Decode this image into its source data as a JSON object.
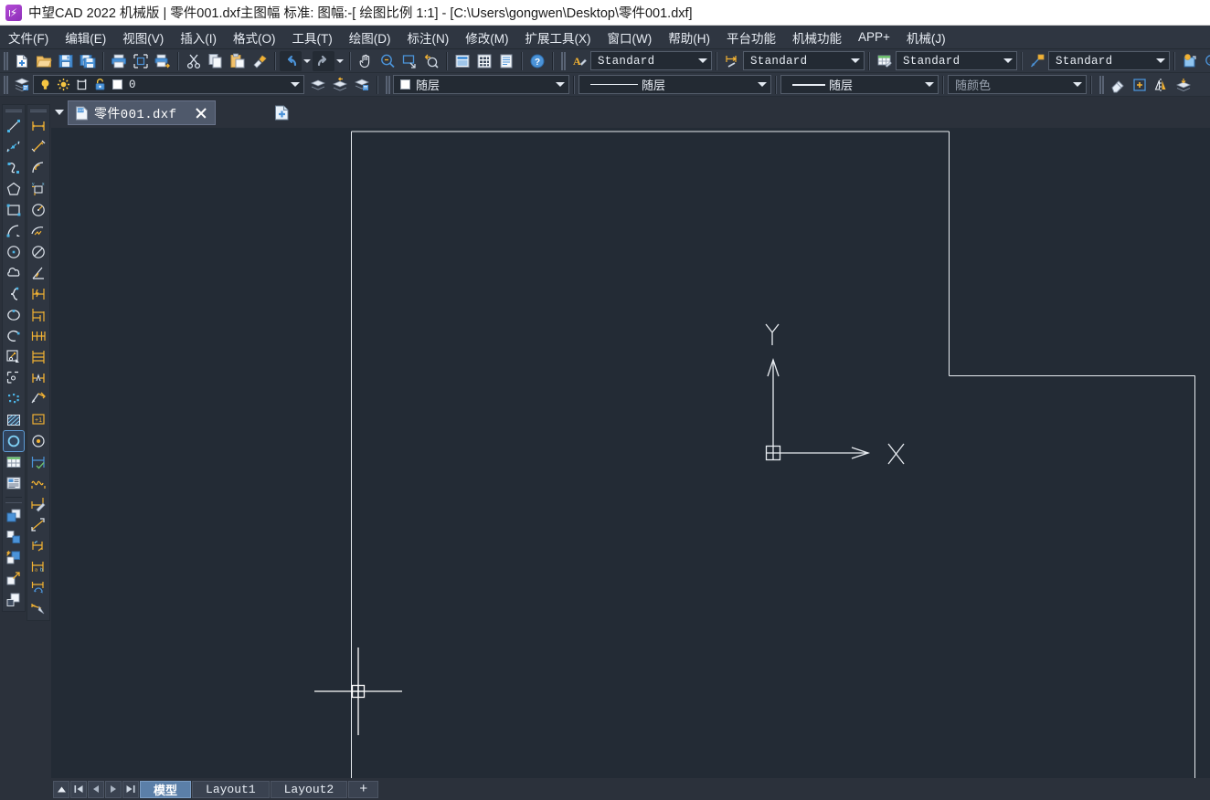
{
  "window": {
    "title": "中望CAD 2022 机械版 | 零件001.dxf主图幅  标准: 图幅:-[ 绘图比例 1:1] - [C:\\Users\\gongwen\\Desktop\\零件001.dxf]",
    "app_name": "中望CAD 2022 机械版",
    "drawing_name": "零件001.dxf主图幅",
    "standard_info": "标准: 图幅:-[ 绘图比例 1:1]",
    "file_path": "C:\\Users\\gongwen\\Desktop\\零件001.dxf",
    "logo_icon": "zwcad-logo-icon"
  },
  "menubar": {
    "items": [
      {
        "label": "文件(F)",
        "mnemonic": "F"
      },
      {
        "label": "编辑(E)",
        "mnemonic": "E"
      },
      {
        "label": "视图(V)",
        "mnemonic": "V"
      },
      {
        "label": "插入(I)",
        "mnemonic": "I"
      },
      {
        "label": "格式(O)",
        "mnemonic": "O"
      },
      {
        "label": "工具(T)",
        "mnemonic": "T"
      },
      {
        "label": "绘图(D)",
        "mnemonic": "D"
      },
      {
        "label": "标注(N)",
        "mnemonic": "N"
      },
      {
        "label": "修改(M)",
        "mnemonic": "M"
      },
      {
        "label": "扩展工具(X)",
        "mnemonic": "X"
      },
      {
        "label": "窗口(W)",
        "mnemonic": "W"
      },
      {
        "label": "帮助(H)",
        "mnemonic": "H"
      },
      {
        "label": "平台功能",
        "mnemonic": ""
      },
      {
        "label": "机械功能",
        "mnemonic": ""
      },
      {
        "label": "APP+",
        "mnemonic": ""
      },
      {
        "label": "机械(J)",
        "mnemonic": "J"
      }
    ]
  },
  "standard_toolbar": {
    "buttons": [
      {
        "name": "new-file-icon",
        "tooltip": "新建"
      },
      {
        "name": "open-file-icon",
        "tooltip": "打开"
      },
      {
        "name": "save-icon",
        "tooltip": "保存"
      },
      {
        "name": "save-as-icon",
        "tooltip": "另存为"
      },
      {
        "name": "print-icon",
        "tooltip": "打印"
      },
      {
        "name": "print-preview-icon",
        "tooltip": "打印预览"
      },
      {
        "name": "plot-icon",
        "tooltip": "输出"
      },
      {
        "name": "cut-icon",
        "tooltip": "剪切"
      },
      {
        "name": "copy-icon",
        "tooltip": "复制"
      },
      {
        "name": "paste-icon",
        "tooltip": "粘贴"
      },
      {
        "name": "match-properties-icon",
        "tooltip": "特性匹配"
      },
      {
        "name": "undo-icon",
        "tooltip": "放弃"
      },
      {
        "name": "redo-icon",
        "tooltip": "重做"
      },
      {
        "name": "pan-icon",
        "tooltip": "实时平移"
      },
      {
        "name": "zoom-realtime-icon",
        "tooltip": "实时缩放"
      },
      {
        "name": "zoom-window-icon",
        "tooltip": "窗口缩放"
      },
      {
        "name": "zoom-previous-icon",
        "tooltip": "缩放上一个"
      },
      {
        "name": "properties-icon",
        "tooltip": "特性"
      },
      {
        "name": "design-center-icon",
        "tooltip": "设计中心"
      },
      {
        "name": "tool-palette-icon",
        "tooltip": "工具选项板"
      },
      {
        "name": "help-icon",
        "tooltip": "帮助"
      }
    ]
  },
  "style_bar": {
    "text_style": {
      "icon": "text-style-icon",
      "value": "Standard"
    },
    "dim_style": {
      "icon": "dimension-style-icon",
      "value": "Standard"
    },
    "table_style": {
      "icon": "table-style-icon",
      "value": "Standard"
    },
    "mleader_style": {
      "icon": "multileader-style-icon",
      "value": "Standard"
    },
    "extra_buttons": [
      {
        "name": "insert-block-icon"
      },
      {
        "name": "zoom-scale-icon"
      },
      {
        "name": "xy-plot-icon"
      },
      {
        "name": "dim-extra-icon"
      }
    ]
  },
  "layer_bar": {
    "layer_manager": {
      "name": "layer-manager-icon",
      "tooltip": "图层特性管理器"
    },
    "layer_state": {
      "on_off_icon": "lightbulb-icon",
      "freeze_icon": "sun-icon",
      "viewport_freeze_icon": "viewport-freeze-icon",
      "lock_icon": "unlock-icon",
      "color_icon": "layer-color-swatch",
      "layer_name": "0"
    },
    "right_buttons": [
      {
        "name": "layer-previous-icon"
      },
      {
        "name": "layer-restore-icon"
      },
      {
        "name": "layer-states-icon"
      }
    ]
  },
  "property_bar": {
    "color": {
      "value": "随层",
      "swatch": "white",
      "icon": "color-swatch-icon"
    },
    "linetype": {
      "value": "随层",
      "icon": "linetype-sample-icon"
    },
    "lineweight": {
      "value": "随层",
      "icon": "lineweight-sample-icon"
    },
    "plot_style": {
      "value": "随颜色",
      "enabled": false
    },
    "right_buttons": [
      {
        "name": "eraser-icon"
      },
      {
        "name": "add-selected-icon"
      },
      {
        "name": "mirror-icon"
      },
      {
        "name": "layer-merge-icon"
      }
    ]
  },
  "document_tabs": {
    "dropdown_icon": "chevron-down-icon",
    "tabs": [
      {
        "label": "零件001.dxf",
        "icon": "dxf-file-icon",
        "active": true,
        "close_icon": "close-icon"
      }
    ],
    "new_tab_icon": "new-tab-icon"
  },
  "draw_toolbar": {
    "title": "绘图",
    "buttons": [
      {
        "name": "line-icon",
        "tooltip": "直线"
      },
      {
        "name": "construction-line-icon",
        "tooltip": "构造线"
      },
      {
        "name": "polyline-icon",
        "tooltip": "多段线"
      },
      {
        "name": "polygon-icon",
        "tooltip": "正多边形"
      },
      {
        "name": "rectangle-icon",
        "tooltip": "矩形"
      },
      {
        "name": "arc-icon",
        "tooltip": "圆弧"
      },
      {
        "name": "circle-icon",
        "tooltip": "圆"
      },
      {
        "name": "revision-cloud-icon",
        "tooltip": "修订云线"
      },
      {
        "name": "spline-icon",
        "tooltip": "样条曲线"
      },
      {
        "name": "ellipse-icon",
        "tooltip": "椭圆"
      },
      {
        "name": "ellipse-arc-icon",
        "tooltip": "椭圆弧"
      },
      {
        "name": "insert-block-icon",
        "tooltip": "插入块"
      },
      {
        "name": "make-block-icon",
        "tooltip": "创建块"
      },
      {
        "name": "point-icon",
        "tooltip": "点"
      },
      {
        "name": "hatch-icon",
        "tooltip": "图案填充"
      },
      {
        "name": "gradient-icon",
        "tooltip": "渐变色"
      },
      {
        "name": "region-icon",
        "tooltip": "面域"
      },
      {
        "name": "table-icon",
        "tooltip": "表格"
      },
      {
        "name": "mtext-icon",
        "tooltip": "多行文字"
      }
    ]
  },
  "modify_toolbar": {
    "title": "修改",
    "buttons": [
      {
        "name": "copy-object-icon",
        "tooltip": "复制"
      },
      {
        "name": "move-icon",
        "tooltip": "移动"
      },
      {
        "name": "rotate-icon",
        "tooltip": "旋转"
      },
      {
        "name": "scale-icon",
        "tooltip": "缩放"
      },
      {
        "name": "trim-icon",
        "tooltip": "修剪"
      }
    ]
  },
  "dimension_toolbar": {
    "title": "标注",
    "buttons": [
      {
        "name": "linear-dimension-icon",
        "tooltip": "线性标注"
      },
      {
        "name": "aligned-dimension-icon",
        "tooltip": "对齐标注"
      },
      {
        "name": "arc-length-dimension-icon",
        "tooltip": "弧长标注"
      },
      {
        "name": "ordinate-dimension-icon",
        "tooltip": "坐标标注"
      },
      {
        "name": "radius-dimension-icon",
        "tooltip": "半径标注"
      },
      {
        "name": "jogged-dimension-icon",
        "tooltip": "折弯标注"
      },
      {
        "name": "diameter-dimension-icon",
        "tooltip": "直径标注"
      },
      {
        "name": "angular-dimension-icon",
        "tooltip": "角度标注"
      },
      {
        "name": "quick-dimension-icon",
        "tooltip": "快速标注"
      },
      {
        "name": "baseline-dimension-icon",
        "tooltip": "基线标注"
      },
      {
        "name": "continue-dimension-icon",
        "tooltip": "连续标注"
      },
      {
        "name": "dim-space-icon",
        "tooltip": "标注间距"
      },
      {
        "name": "dim-break-icon",
        "tooltip": "标注打断"
      },
      {
        "name": "tolerance-icon",
        "tooltip": "公差"
      },
      {
        "name": "center-mark-icon",
        "tooltip": "圆心标记"
      },
      {
        "name": "inspection-dimension-icon",
        "tooltip": "检验"
      },
      {
        "name": "jogged-linear-icon",
        "tooltip": "折弯线性"
      },
      {
        "name": "edit-dimension-icon",
        "tooltip": "编辑标注"
      },
      {
        "name": "edit-dim-text-icon",
        "tooltip": "编辑标注文字"
      },
      {
        "name": "dim-update-icon",
        "tooltip": "标注更新"
      },
      {
        "name": "dim-style-control-icon",
        "tooltip": "标注样式"
      },
      {
        "name": "dim-override-icon",
        "tooltip": "替代"
      },
      {
        "name": "dim-reassociate-icon",
        "tooltip": "重新关联标注"
      }
    ]
  },
  "canvas": {
    "background_color": "#232b35",
    "ucs_icon": {
      "x_label": "X",
      "y_label": "Y",
      "origin_marker": "ucs-origin-box"
    },
    "crosshair": {
      "pickbox": "pickbox-square"
    },
    "drawing_border": {
      "color": "#e8ecf1",
      "description": "零件图幅边框"
    }
  },
  "layout_tabs": {
    "nav_buttons": [
      {
        "name": "model-layout-toggle-icon",
        "glyph": "▲"
      },
      {
        "name": "first-layout-icon",
        "glyph": "|◀"
      },
      {
        "name": "prev-layout-icon",
        "glyph": "◀"
      },
      {
        "name": "next-layout-icon",
        "glyph": "▶"
      },
      {
        "name": "last-layout-icon",
        "glyph": "▶|"
      }
    ],
    "tabs": [
      {
        "label": "模型",
        "active": true
      },
      {
        "label": "Layout1",
        "active": false
      },
      {
        "label": "Layout2",
        "active": false
      }
    ],
    "add_label": "+"
  },
  "colors": {
    "titlebar_bg": "#ffffff",
    "chrome_bg": "#2f3641",
    "panel_bg": "#2b313b",
    "canvas_bg": "#232b35",
    "text_light": "#e9eef5",
    "accent_blue": "#5b7fa8",
    "icon_orange": "#f2b233",
    "icon_blue": "#4b93d8"
  }
}
